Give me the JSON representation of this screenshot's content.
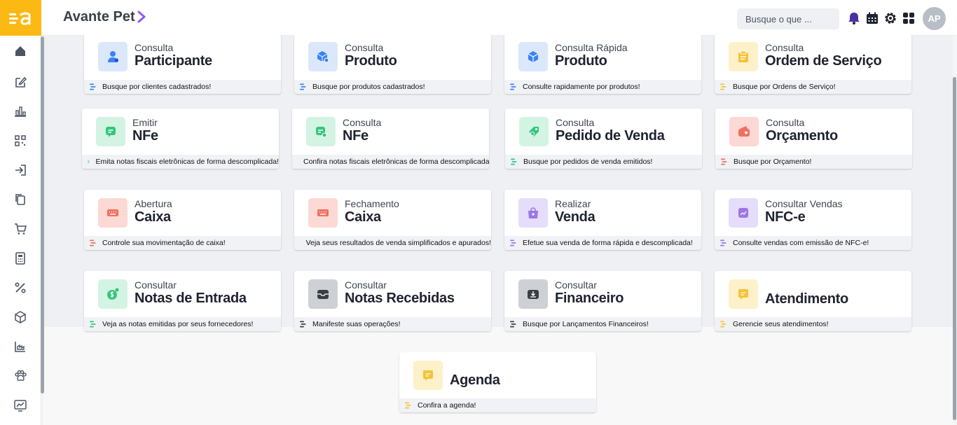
{
  "app": {
    "title": "Avante Pet",
    "logo_text": "=a"
  },
  "search": {
    "placeholder": "Busque o que ..."
  },
  "user": {
    "initials": "AP"
  },
  "colors": {
    "brand": "#fdb913",
    "blue_bg": "#dbe8fb",
    "blue_fg": "#3b82f6",
    "yellow_bg": "#fdf1c9",
    "yellow_fg": "#f6c238",
    "green_bg": "#d4f4e3",
    "green_fg": "#34c77b",
    "red_bg": "#fcd9d4",
    "red_fg": "#f0705f",
    "purple_bg": "#e6dcfb",
    "purple_fg": "#9b78e3",
    "dark_bg": "#cdd0d4",
    "dark_fg": "#3b3f45"
  },
  "sidebar": {
    "items": [
      {
        "icon": "home-icon"
      },
      {
        "icon": "edit-icon"
      },
      {
        "icon": "bar-chart-icon"
      },
      {
        "icon": "qr-code-icon"
      },
      {
        "icon": "login-icon"
      },
      {
        "icon": "copy-icon"
      },
      {
        "icon": "cart-icon"
      },
      {
        "icon": "calculator-icon"
      },
      {
        "icon": "percent-icon"
      },
      {
        "icon": "box-icon"
      },
      {
        "icon": "factory-chart-icon"
      },
      {
        "icon": "paw-icon"
      },
      {
        "icon": "trend-chart-icon"
      }
    ]
  },
  "cards": [
    {
      "sub": "Consulta",
      "title": "Participante",
      "foot": "Busque por clientes cadastrados!",
      "color": "blue",
      "icon": "user-icon"
    },
    {
      "sub": "Consulta",
      "title": "Produto",
      "foot": "Busque por produtos cadastrados!",
      "color": "blue",
      "icon": "box-search-icon"
    },
    {
      "sub": "Consulta Rápida",
      "title": "Produto",
      "foot": "Consulte rapidamente por produtos!",
      "color": "blue",
      "icon": "box-fast-icon"
    },
    {
      "sub": "Consulta",
      "title": "Ordem de Serviço",
      "foot": "Busque por Ordens de Serviço!",
      "color": "yellow",
      "icon": "service-order-icon"
    },
    {
      "sub": "Emitir",
      "title": "NFe",
      "foot": "Emita notas fiscais eletrônicas de forma descomplicada!",
      "color": "green",
      "icon": "invoice-icon"
    },
    {
      "sub": "Consulta",
      "title": "NFe",
      "foot": "Confira notas fiscais eletrônicas de forma descomplicada!",
      "color": "green",
      "icon": "invoice-search-icon"
    },
    {
      "sub": "Consulta",
      "title": "Pedido de Venda",
      "foot": "Busque por pedidos de venda emitidos!",
      "color": "green",
      "icon": "tag-icon"
    },
    {
      "sub": "Consulta",
      "title": "Orçamento",
      "foot": "Busque por Orçamento!",
      "color": "red",
      "icon": "wallet-icon"
    },
    {
      "sub": "Abertura",
      "title": "Caixa",
      "foot": "Controle sua movimentação de caixa!",
      "color": "red",
      "icon": "keyboard-icon"
    },
    {
      "sub": "Fechamento",
      "title": "Caixa",
      "foot": "Veja seus resultados de venda simplificados e apurados!",
      "color": "red",
      "icon": "keyboard-icon"
    },
    {
      "sub": "Realizar",
      "title": "Venda",
      "foot": "Efetue sua venda de forma rápida e descomplicada!",
      "color": "purple",
      "icon": "shopping-bag-icon"
    },
    {
      "sub": "Consultar Vendas",
      "title": "NFC-e",
      "foot": "Consulte vendas com emissão de NFC-e!",
      "color": "purple",
      "icon": "sales-chart-icon"
    },
    {
      "sub": "Consultar",
      "title": "Notas de Entrada",
      "foot": "Veja as notas emitidas por seus fornecedores!",
      "color": "green",
      "icon": "money-icon"
    },
    {
      "sub": "Consultar",
      "title": "Notas Recebidas",
      "foot": "Manifeste suas operações!",
      "color": "dark",
      "icon": "inbox-icon"
    },
    {
      "sub": "Consultar",
      "title": "Financeiro",
      "foot": "Busque por Lançamentos Financeiros!",
      "color": "dark",
      "icon": "finance-icon"
    },
    {
      "sub": "",
      "title": "Atendimento",
      "foot": "Gerencie seus atendimentos!",
      "color": "yellow",
      "icon": "chat-icon"
    },
    {
      "sub": "",
      "title": "Agenda",
      "foot": "Confira a agenda!",
      "color": "yellow",
      "icon": "calendar-note-icon"
    }
  ]
}
